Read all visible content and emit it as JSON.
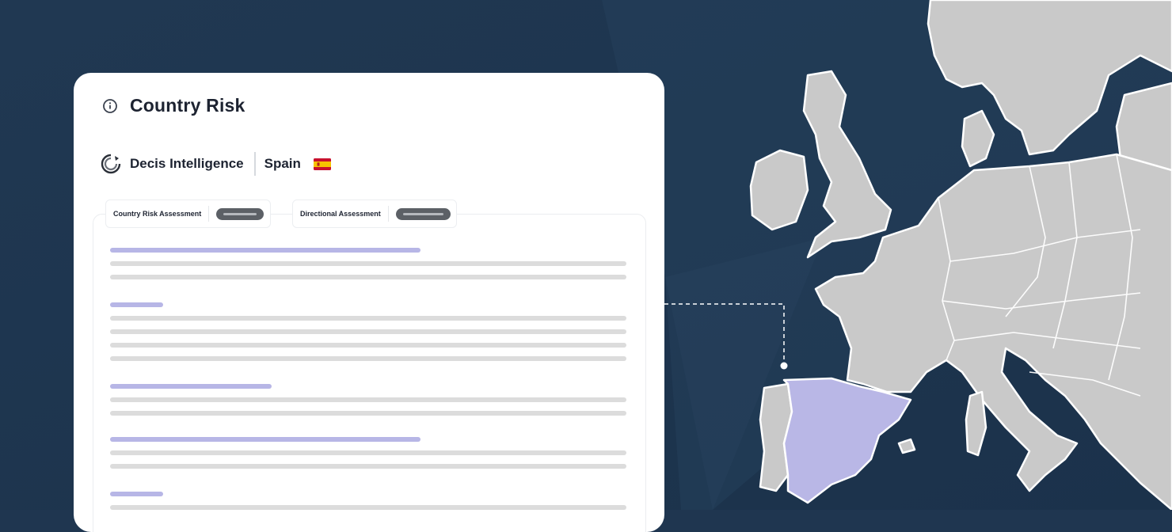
{
  "header": {
    "title": "Country Risk"
  },
  "brand": {
    "name": "Decis Intelligence",
    "country": "Spain"
  },
  "tabs": [
    {
      "label": "Country Risk Assessment"
    },
    {
      "label": "Directional Assessment"
    }
  ],
  "icons": {
    "info": "info-icon",
    "logo": "decis-logo-icon",
    "flag": "spain-flag-icon"
  },
  "colors": {
    "background": "#1f3650",
    "highlight_country": "#b9b7e6",
    "land": "#c9c9c9"
  }
}
